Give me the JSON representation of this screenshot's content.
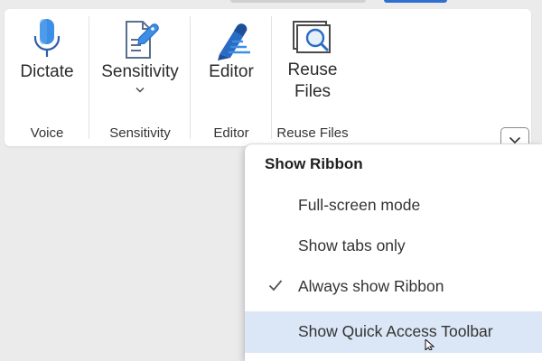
{
  "ribbon": {
    "groups": [
      {
        "button_label": "Dictate",
        "group_name": "Voice",
        "icon": "microphone-icon"
      },
      {
        "button_label": "Sensitivity",
        "group_name": "Sensitivity",
        "icon": "sensitivity-label-icon",
        "has_dropdown": true
      },
      {
        "button_label": "Editor",
        "group_name": "Editor",
        "icon": "editor-pen-icon"
      },
      {
        "button_label_line1": "Reuse",
        "button_label_line2": "Files",
        "group_name": "Reuse Files",
        "icon": "reuse-files-icon"
      }
    ],
    "collapse_icon": "chevron-down-icon"
  },
  "menu": {
    "title": "Show Ribbon",
    "items": [
      {
        "label": "Full-screen mode",
        "checked": false
      },
      {
        "label": "Show tabs only",
        "checked": false
      },
      {
        "label": "Always show Ribbon",
        "checked": true
      },
      {
        "label": "Show Quick Access Toolbar",
        "checked": false,
        "hovered": true
      }
    ]
  },
  "colors": {
    "accent_blue": "#2a6bc4",
    "hover_highlight": "#dbe6f6",
    "background": "#ebebeb"
  }
}
